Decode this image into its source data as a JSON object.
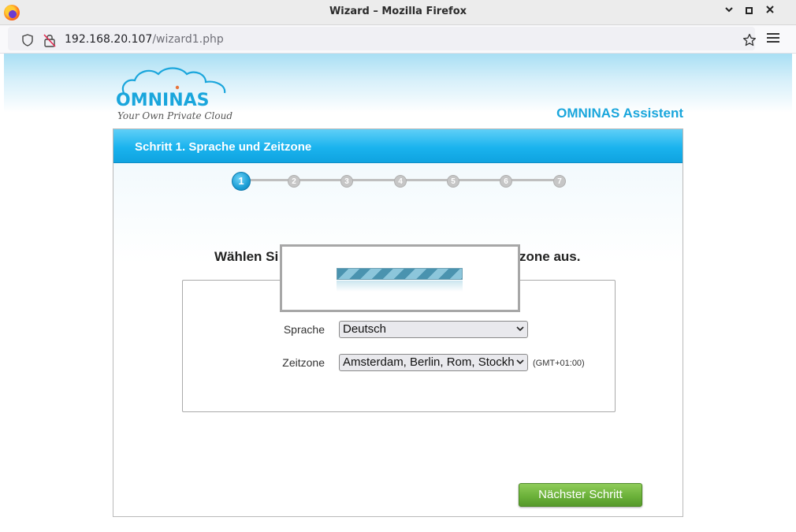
{
  "window": {
    "title": "Wizard – Mozilla Firefox",
    "controls": {
      "minimize": "–",
      "close": "✕"
    }
  },
  "navbar": {
    "url_host": "192.168.20.107",
    "url_path": "/wizard1.php"
  },
  "header": {
    "logo_brand": "OMNINAS",
    "logo_tagline": "Your Own Private Cloud",
    "assistant_title": "OMNINAS Assistent"
  },
  "wizard": {
    "step_title": "Schritt 1. Sprache und Zeitzone",
    "steps": [
      "1",
      "2",
      "3",
      "4",
      "5",
      "6",
      "7"
    ],
    "active_step": 1,
    "instruction_visible_left": "Wählen Si",
    "instruction_visible_right": "zone aus.",
    "language": {
      "label": "Sprache",
      "value": "Deutsch"
    },
    "timezone": {
      "label": "Zeitzone",
      "value": "Amsterdam, Berlin, Rom, Stockh",
      "offset": "(GMT+01:00)"
    },
    "next_label": "Nächster Schritt"
  },
  "colors": {
    "accent": "#1aa6dc",
    "header_blue": "#1ab3ee",
    "next_green": "#6cb23a"
  }
}
